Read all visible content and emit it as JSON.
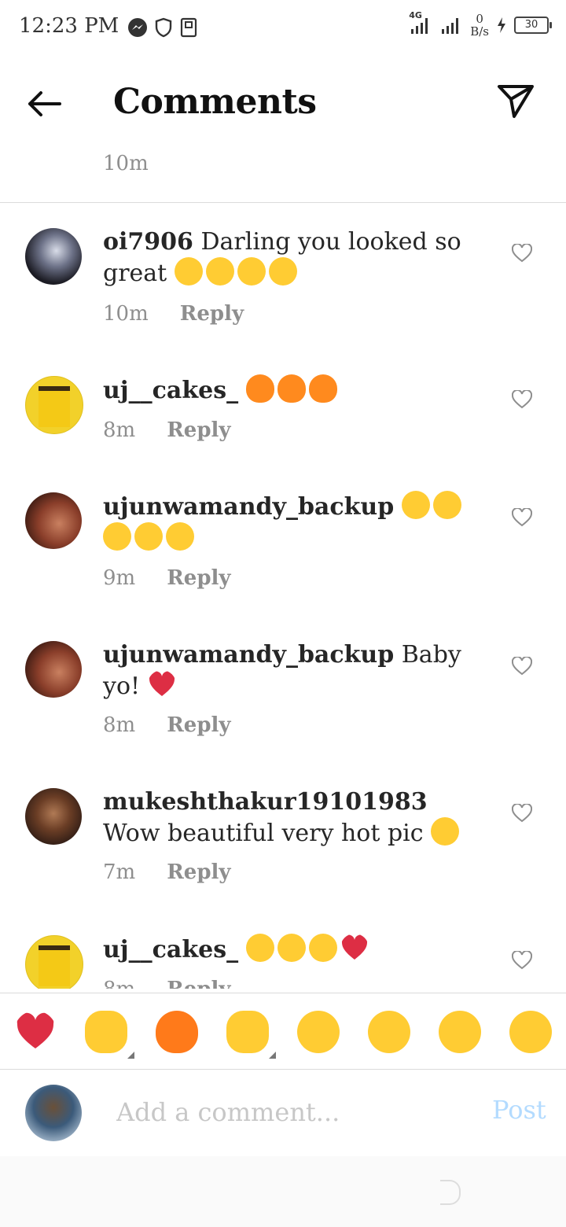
{
  "status": {
    "time": "12:23 PM",
    "network": "4G",
    "speed_value": "0",
    "speed_unit": "B/s",
    "battery": "30"
  },
  "header": {
    "title": "Comments"
  },
  "caption": {
    "time": "10m"
  },
  "comments": [
    {
      "username": "oi7906",
      "text": "Darling you looked so great",
      "emojis": [
        "kiss",
        "kiss",
        "kiss",
        "kiss"
      ],
      "time": "10m",
      "reply": "Reply"
    },
    {
      "username": "uj__cakes_",
      "text": "",
      "emojis": [
        "fire",
        "fire",
        "fire"
      ],
      "time": "8m",
      "reply": "Reply"
    },
    {
      "username": "ujunwamandy_backup",
      "text": "",
      "emojis": [
        "heart-eyes",
        "heart-eyes",
        "heart-eyes",
        "heart-eyes",
        "heart-eyes"
      ],
      "time": "9m",
      "reply": "Reply"
    },
    {
      "username": "ujunwamandy_backup",
      "text": "Baby yo!",
      "emojis": [
        "red-heart"
      ],
      "time": "8m",
      "reply": "Reply"
    },
    {
      "username": "mukeshthakur19101983",
      "text": "Wow beautiful very hot pic",
      "emojis": [
        "heart-eyes"
      ],
      "time": "7m",
      "reply": "Reply"
    },
    {
      "username": "uj__cakes_",
      "text": "",
      "emojis": [
        "heart-eyes",
        "heart-eyes",
        "heart-eyes",
        "red-heart"
      ],
      "time": "8m",
      "reply": "Reply"
    }
  ],
  "reactions": [
    "red-heart",
    "raising-hands",
    "fire",
    "clapping-hands",
    "sad-tear",
    "heart-eyes",
    "surprised",
    "tears-of-joy"
  ],
  "composer": {
    "placeholder": "Add a comment...",
    "post_label": "Post"
  },
  "colors": {
    "text": "#262626",
    "secondary": "#8e8e8e",
    "divider": "#dbdbdb",
    "post_disabled": "#b3dbff",
    "placeholder": "#c7c7c7"
  }
}
